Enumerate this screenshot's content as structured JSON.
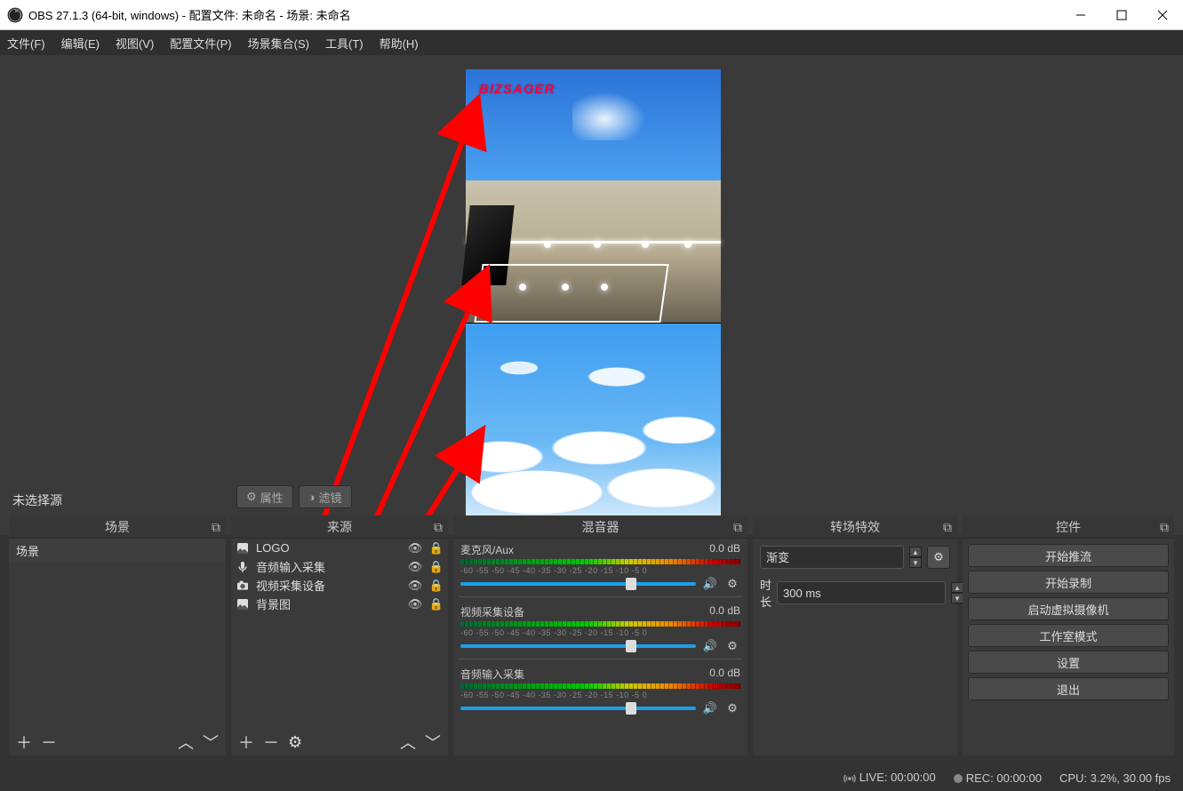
{
  "window": {
    "title": "OBS 27.1.3 (64-bit, windows) - 配置文件: 未命名 - 场景: 未命名"
  },
  "menu": {
    "file": "文件(F)",
    "edit": "编辑(E)",
    "view": "视图(V)",
    "profile": "配置文件(P)",
    "scenecol": "场景集合(S)",
    "tools": "工具(T)",
    "help": "帮助(H)"
  },
  "preview": {
    "brand": "BIZSAGER",
    "no_selection": "未选择源",
    "btn_props": "属性",
    "btn_filters": "滤镜"
  },
  "panels": {
    "scenes_title": "场景",
    "sources_title": "来源",
    "mixer_title": "混音器",
    "trans_title": "转场特效",
    "ctrls_title": "控件"
  },
  "scenes": {
    "items": [
      "场景"
    ]
  },
  "sources": {
    "items": [
      {
        "name": "LOGO",
        "icon": "image"
      },
      {
        "name": "音频输入采集",
        "icon": "mic"
      },
      {
        "name": "视频采集设备",
        "icon": "cam"
      },
      {
        "name": "背景图",
        "icon": "image"
      }
    ]
  },
  "mixer": {
    "scale": "-60  -55  -50  -45  -40  -35  -30  -25  -20  -15  -10  -5  0",
    "tracks": [
      {
        "name": "麦克风/Aux",
        "level": "0.0 dB",
        "knob": 0.7
      },
      {
        "name": "视频采集设备",
        "level": "0.0 dB",
        "knob": 0.7
      },
      {
        "name": "音频输入采集",
        "level": "0.0 dB",
        "knob": 0.7
      }
    ]
  },
  "trans": {
    "type": "渐变",
    "dur_label": "时长",
    "dur_value": "300 ms"
  },
  "ctrls": {
    "buttons": [
      "开始推流",
      "开始录制",
      "启动虚拟摄像机",
      "工作室模式",
      "设置",
      "退出"
    ]
  },
  "status": {
    "live": "LIVE: 00:00:00",
    "rec": "REC: 00:00:00",
    "cpu": "CPU: 3.2%, 30.00 fps"
  }
}
